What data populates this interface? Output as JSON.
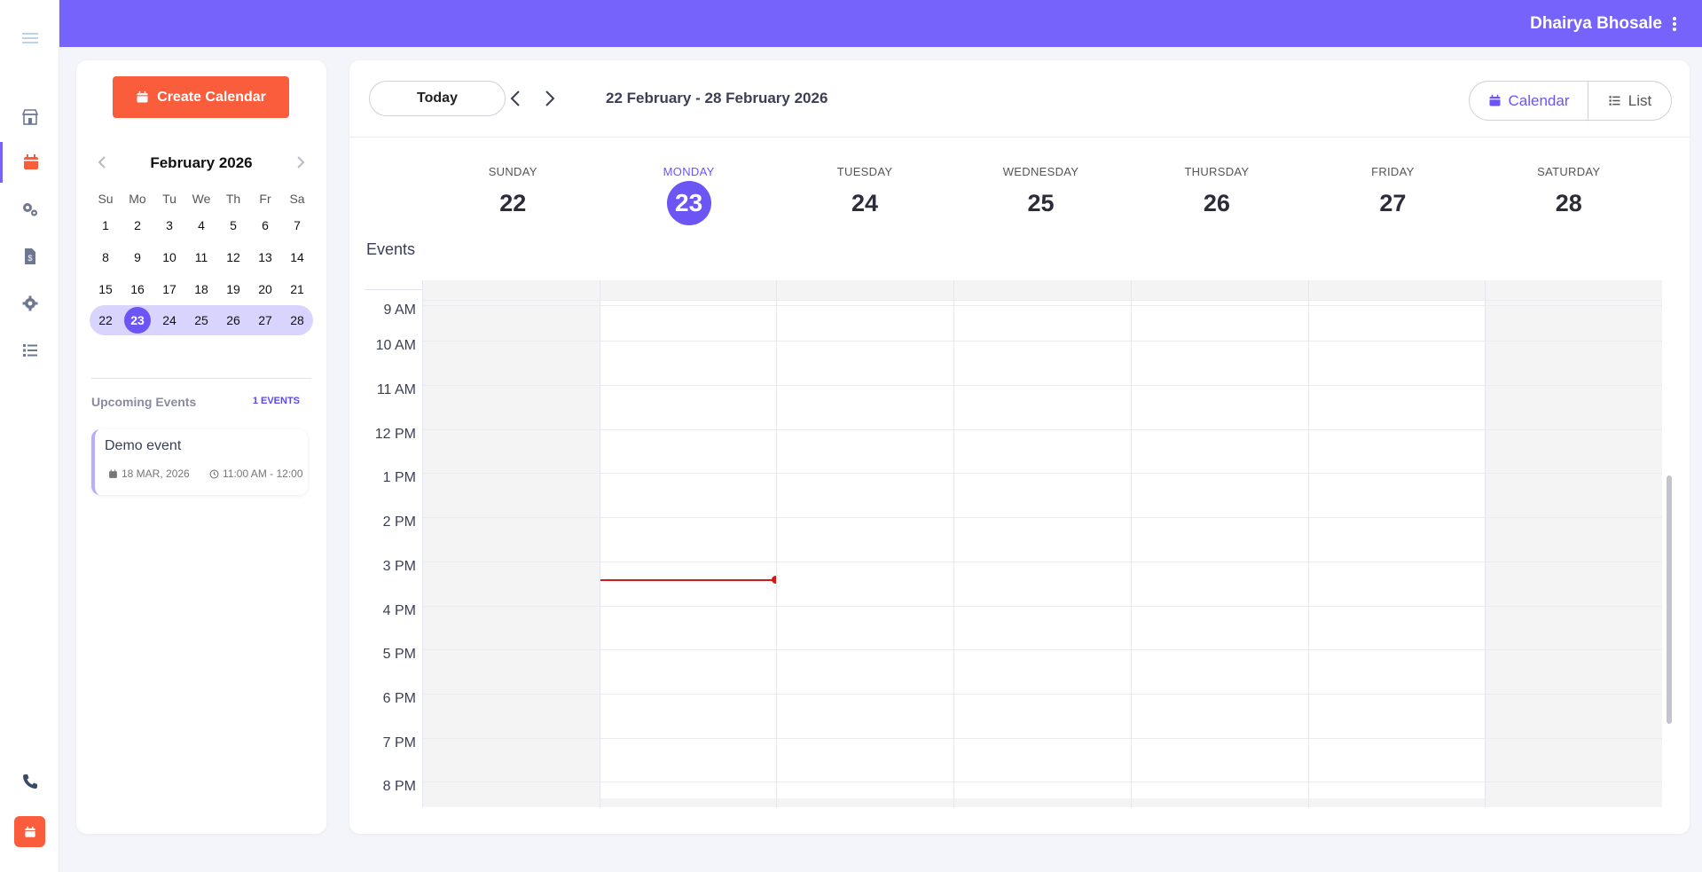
{
  "header": {
    "user_name": "Dhairya Bhosale"
  },
  "rail": {
    "items": [
      {
        "icon": "menu-icon"
      },
      {
        "icon": "store-icon"
      },
      {
        "icon": "calendar-icon",
        "active": true
      },
      {
        "icon": "cogs-icon"
      },
      {
        "icon": "invoice-icon"
      },
      {
        "icon": "gear-icon"
      },
      {
        "icon": "list-icon"
      }
    ],
    "bottom": [
      {
        "icon": "phone-icon"
      },
      {
        "icon": "calendar-icon"
      }
    ]
  },
  "sidebar": {
    "create_label": "Create Calendar",
    "mini_calendar": {
      "title": "February 2026",
      "weekdays": [
        "Su",
        "Mo",
        "Tu",
        "We",
        "Th",
        "Fr",
        "Sa"
      ],
      "weeks": [
        [
          "1",
          "2",
          "3",
          "4",
          "5",
          "6",
          "7"
        ],
        [
          "8",
          "9",
          "10",
          "11",
          "12",
          "13",
          "14"
        ],
        [
          "15",
          "16",
          "17",
          "18",
          "19",
          "20",
          "21"
        ],
        [
          "22",
          "23",
          "24",
          "25",
          "26",
          "27",
          "28"
        ]
      ],
      "selected_week_index": 3,
      "today": "23"
    },
    "upcoming": {
      "title": "Upcoming Events",
      "count_label": "1 EVENTS",
      "events": [
        {
          "name": "Demo event",
          "date": "18 MAR, 2026",
          "time": "11:00 AM - 12:00"
        }
      ]
    }
  },
  "toolbar": {
    "today_label": "Today",
    "range_label": "22 February - 28 February 2026",
    "view_calendar_label": "Calendar",
    "view_list_label": "List",
    "active_view": "Calendar"
  },
  "week": {
    "days": [
      {
        "name": "SUNDAY",
        "num": "22"
      },
      {
        "name": "MONDAY",
        "num": "23",
        "current": true
      },
      {
        "name": "TUESDAY",
        "num": "24"
      },
      {
        "name": "WEDNESDAY",
        "num": "25"
      },
      {
        "name": "THURSDAY",
        "num": "26"
      },
      {
        "name": "FRIDAY",
        "num": "27"
      },
      {
        "name": "SATURDAY",
        "num": "28"
      }
    ],
    "events_label": "Events",
    "hours": [
      "9 AM",
      "10 AM",
      "11 AM",
      "12 PM",
      "1 PM",
      "2 PM",
      "3 PM",
      "4 PM",
      "5 PM",
      "6 PM",
      "7 PM",
      "8 PM"
    ]
  },
  "colors": {
    "accent": "#6b55f5",
    "header_bg": "#7563fc",
    "primary_button": "#fa5d3b",
    "now_indicator": "#d21a1a"
  }
}
